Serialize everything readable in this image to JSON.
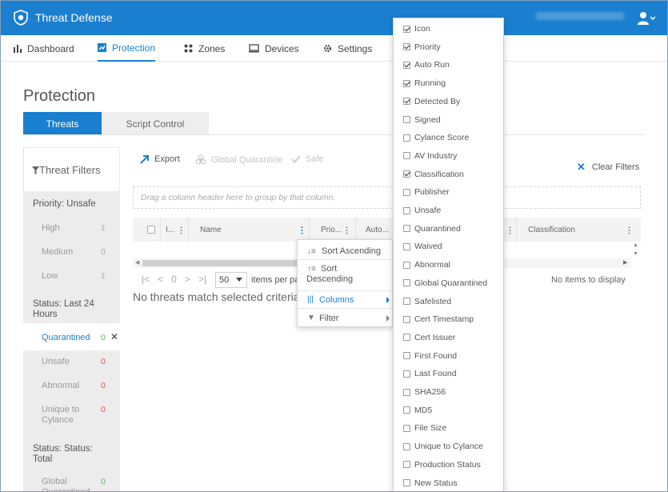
{
  "app": {
    "title": "Threat Defense"
  },
  "nav": {
    "items": [
      {
        "label": "Dashboard",
        "icon": "bar-chart-icon",
        "active": false
      },
      {
        "label": "Protection",
        "icon": "shield-icon",
        "active": true
      },
      {
        "label": "Zones",
        "icon": "zones-icon",
        "active": false
      },
      {
        "label": "Devices",
        "icon": "monitor-icon",
        "active": false
      },
      {
        "label": "Settings",
        "icon": "gear-icon",
        "active": false
      }
    ]
  },
  "page": {
    "title": "Protection",
    "tabs": [
      {
        "label": "Threats",
        "active": true
      },
      {
        "label": "Script Control",
        "active": false
      }
    ]
  },
  "filters": {
    "title": "Threat Filters",
    "sections": [
      {
        "heading": "Priority: Unsafe",
        "items": [
          {
            "label": "High",
            "count": "1"
          },
          {
            "label": "Medium",
            "count": "0"
          },
          {
            "label": "Low",
            "count": "1"
          }
        ]
      },
      {
        "heading": "Status: Last 24 Hours",
        "items": [
          {
            "label": "Quarantined",
            "count": "0",
            "selected": true
          },
          {
            "label": "Unsafe",
            "count": "0"
          },
          {
            "label": "Abnormal",
            "count": "0"
          },
          {
            "label": "Unique to Cylance",
            "count": "0"
          }
        ]
      },
      {
        "heading": "Status: Status: Total",
        "items": [
          {
            "label": "Global Quarantined",
            "count": "0"
          }
        ]
      }
    ]
  },
  "toolbar": {
    "export": "Export",
    "global_quarantine": "Global Quarantine",
    "safe": "Safe",
    "clear_filters": "Clear Filters"
  },
  "grid": {
    "group_hint": "Drag a column header here to group by that column.",
    "headers": {
      "icon": "I...",
      "name": "Name",
      "priority": "Prio...",
      "auto_run": "Auto...",
      "classification": "Classification"
    },
    "page_size": "50",
    "per_page_label": "items per pa",
    "page_number": "0",
    "no_items": "No items to display",
    "no_match": "No threats match selected criteria"
  },
  "context_menu": {
    "sort_ascending": "Sort Ascending",
    "sort_descending": "Sort Descending",
    "columns": "Columns",
    "filter": "Filter"
  },
  "columns_menu": [
    {
      "label": "Icon",
      "checked": true
    },
    {
      "label": "Priority",
      "checked": true
    },
    {
      "label": "Auto Run",
      "checked": true
    },
    {
      "label": "Running",
      "checked": true
    },
    {
      "label": "Detected By",
      "checked": true
    },
    {
      "label": "Signed",
      "checked": false
    },
    {
      "label": "Cylance Score",
      "checked": false
    },
    {
      "label": "AV Industry",
      "checked": false
    },
    {
      "label": "Classification",
      "checked": true
    },
    {
      "label": "Publisher",
      "checked": false
    },
    {
      "label": "Unsafe",
      "checked": false
    },
    {
      "label": "Quarantined",
      "checked": false
    },
    {
      "label": "Waived",
      "checked": false
    },
    {
      "label": "Abnormal",
      "checked": false
    },
    {
      "label": "Global Quarantined",
      "checked": false
    },
    {
      "label": "Safelisted",
      "checked": false
    },
    {
      "label": "Cert Timestamp",
      "checked": false
    },
    {
      "label": "Cert Issuer",
      "checked": false
    },
    {
      "label": "First Found",
      "checked": false
    },
    {
      "label": "Last Found",
      "checked": false
    },
    {
      "label": "SHA256",
      "checked": false
    },
    {
      "label": "MD5",
      "checked": false
    },
    {
      "label": "File Size",
      "checked": false
    },
    {
      "label": "Unique to Cylance",
      "checked": false
    },
    {
      "label": "Production Status",
      "checked": false
    },
    {
      "label": "New Status",
      "checked": false
    }
  ],
  "colors": {
    "accent": "#1a7fcf",
    "count_red": "#d9534f",
    "count_green": "#5cb85c",
    "sidebar_bg": "#ececec"
  }
}
